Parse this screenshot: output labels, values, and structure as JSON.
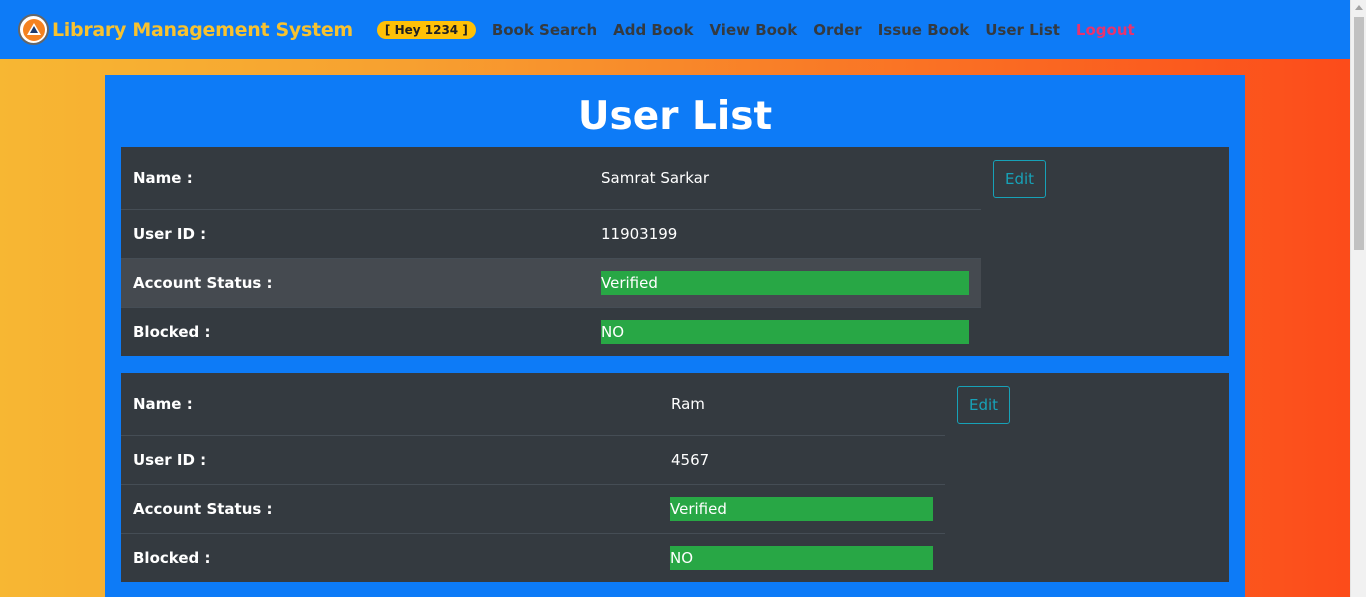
{
  "nav": {
    "brand": "Library Management System",
    "greeting": "[ Hey 1234 ]",
    "links": [
      "Book Search",
      "Add Book",
      "View Book",
      "Order",
      "Issue Book",
      "User List"
    ],
    "logout": "Logout"
  },
  "page": {
    "title": "User List"
  },
  "labels": {
    "name": "Name :",
    "user_id": "User ID :",
    "account_status": "Account Status :",
    "blocked": "Blocked :",
    "edit": "Edit"
  },
  "users": [
    {
      "name": "Samrat Sarkar",
      "user_id": "11903199",
      "account_status": "Verified",
      "blocked": "NO"
    },
    {
      "name": "Ram",
      "user_id": "4567",
      "account_status": "Verified",
      "blocked": "NO"
    }
  ],
  "colors": {
    "navbar": "#0d7bf7",
    "brand": "#f7c230",
    "card": "#343a40",
    "status_green": "#28a745",
    "edit_outline": "#17a2b8",
    "logout": "#e8336e"
  }
}
